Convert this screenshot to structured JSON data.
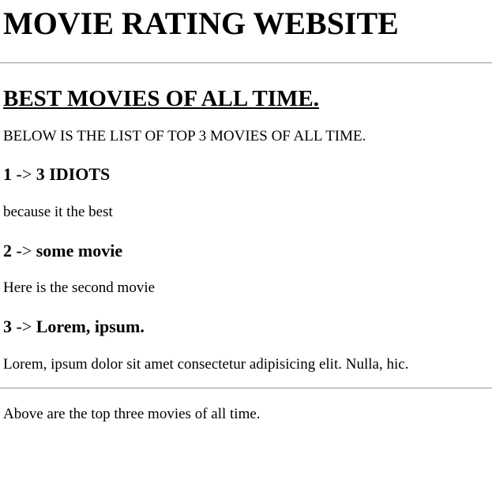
{
  "header": {
    "title": "MOVIE RATING WEBSITE"
  },
  "main": {
    "section_title": "BEST MOVIES OF ALL TIME.",
    "intro": "BELOW IS THE LIST OF TOP 3 MOVIES OF ALL TIME.",
    "movies": [
      {
        "rank": "1",
        "arrow": "->",
        "title": "3 IDIOTS",
        "description": "because it the best"
      },
      {
        "rank": "2",
        "arrow": "->",
        "title": "some movie",
        "description": "Here is the second movie"
      },
      {
        "rank": "3",
        "arrow": "->",
        "title": "Lorem, ipsum.",
        "description": "Lorem, ipsum dolor sit amet consectetur adipisicing elit. Nulla, hic."
      }
    ]
  },
  "footer": {
    "text": "Above are the top three movies of all time."
  }
}
